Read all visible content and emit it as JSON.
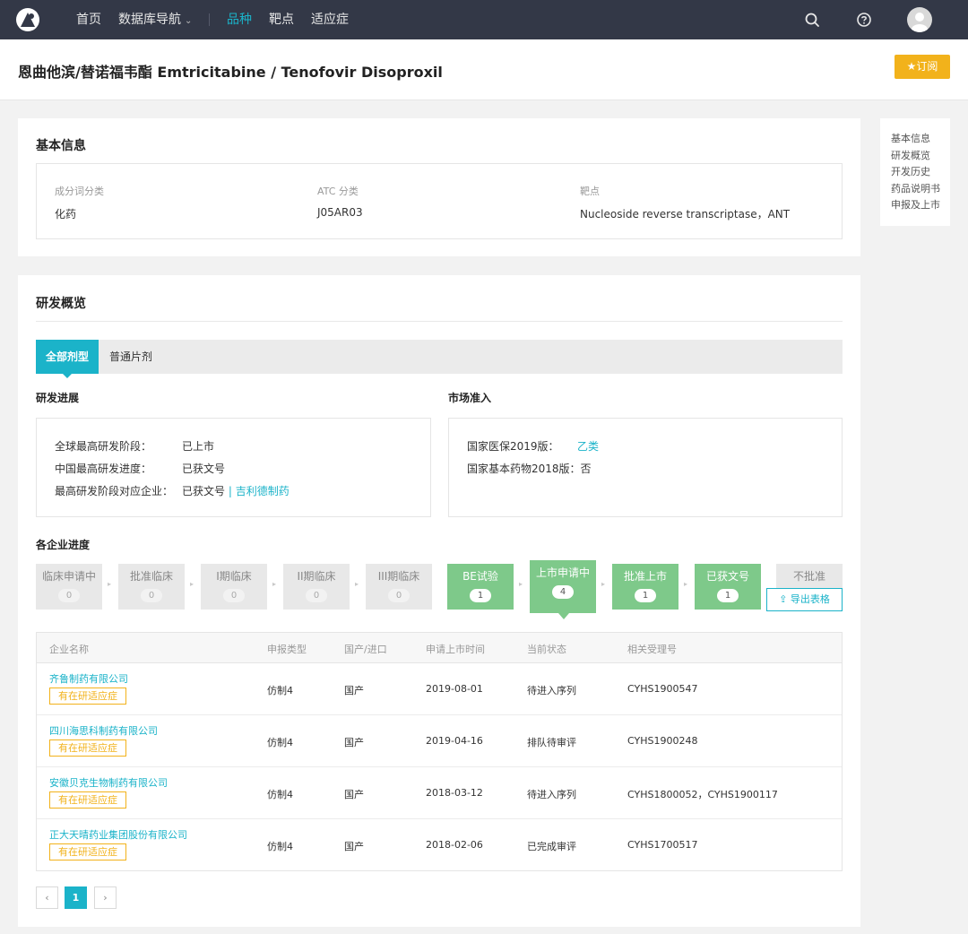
{
  "nav": {
    "items": [
      {
        "label": "首页",
        "active": false
      },
      {
        "label": "数据库导航",
        "active": false,
        "has_dropdown": true
      },
      {
        "label": "品种",
        "active": true
      },
      {
        "label": "靶点",
        "active": false
      },
      {
        "label": "适应症",
        "active": false
      }
    ],
    "icons": [
      "search-icon",
      "help-icon",
      "avatar"
    ]
  },
  "header": {
    "title": "恩曲他滨/替诺福韦酯 Emtricitabine / Tenofovir Disoproxil",
    "subscribe_label": "订阅",
    "subscribe_icon": "star-icon"
  },
  "side_nav": [
    "基本信息",
    "研发概览",
    "开发历史",
    "药品说明书",
    "申报及上市"
  ],
  "basic_info": {
    "title": "基本信息",
    "fields": [
      {
        "label": "成分词分类",
        "value": "化药"
      },
      {
        "label": "ATC 分类",
        "value": "J05AR03"
      },
      {
        "label": "靶点",
        "value": "Nucleoside reverse transcriptase，ANT"
      }
    ]
  },
  "overview": {
    "title": "研发概览",
    "tabs": [
      {
        "label": "全部剂型",
        "active": true
      },
      {
        "label": "普通片剂",
        "active": false
      }
    ],
    "progress": {
      "title": "研发进展",
      "rows": [
        {
          "label": "全球最高研发阶段：",
          "value": "已上市"
        },
        {
          "label": "中国最高研发进度：",
          "value": "已获文号"
        },
        {
          "label": "最高研发阶段对应企业：",
          "value": "已获文号",
          "separator": "|",
          "link": "吉利德制药"
        }
      ]
    },
    "market": {
      "title": "市场准入",
      "rows": [
        {
          "label": "国家医保2019版：",
          "value": "乙类"
        },
        {
          "label": "国家基本药物2018版：",
          "value": "否"
        }
      ]
    },
    "companies": {
      "title": "各企业进度",
      "stages": [
        {
          "name": "临床申请中",
          "count": "0",
          "highlight": false
        },
        {
          "name": "批准临床",
          "count": "0",
          "highlight": false
        },
        {
          "name": "I期临床",
          "count": "0",
          "highlight": false
        },
        {
          "name": "II期临床",
          "count": "0",
          "highlight": false
        },
        {
          "name": "III期临床",
          "count": "0",
          "highlight": false
        },
        {
          "name": "BE试验",
          "count": "1",
          "highlight": true
        },
        {
          "name": "上市申请中",
          "count": "4",
          "highlight": true,
          "selected": true
        },
        {
          "name": "批准上市",
          "count": "1",
          "highlight": true
        },
        {
          "name": "已获文号",
          "count": "1",
          "highlight": true
        },
        {
          "name": "不批准",
          "count": "",
          "highlight": false
        }
      ],
      "separator": "/",
      "export_label": "导出表格",
      "export_icon": "export-icon"
    },
    "table": {
      "headers": [
        "企业名称",
        "申报类型",
        "国产/进口",
        "申请上市时间",
        "当前状态",
        "相关受理号"
      ],
      "rows": [
        {
          "company": "齐鲁制药有限公司",
          "tag": "有在研适应症",
          "type": "仿制4",
          "origin": "国产",
          "date": "2019-08-01",
          "status": "待进入序列",
          "accept_no": "CYHS1900547"
        },
        {
          "company": "四川海思科制药有限公司",
          "tag": "有在研适应症",
          "type": "仿制4",
          "origin": "国产",
          "date": "2019-04-16",
          "status": "排队待审评",
          "accept_no": "CYHS1900248"
        },
        {
          "company": "安徽贝克生物制药有限公司",
          "tag": "有在研适应症",
          "type": "仿制4",
          "origin": "国产",
          "date": "2018-03-12",
          "status": "待进入序列",
          "accept_no": "CYHS1800052，CYHS1900117"
        },
        {
          "company": "正大天晴药业集团股份有限公司",
          "tag": "有在研适应症",
          "type": "仿制4",
          "origin": "国产",
          "date": "2018-02-06",
          "status": "已完成审评",
          "accept_no": "CYHS1700517"
        }
      ]
    },
    "pager": {
      "prev": "‹",
      "current": "1",
      "next": "›"
    }
  },
  "colors": {
    "accent": "#1bb3c9",
    "nav_bg": "#333847",
    "warning": "#f2b21b",
    "stage_green": "#7ec98a"
  }
}
